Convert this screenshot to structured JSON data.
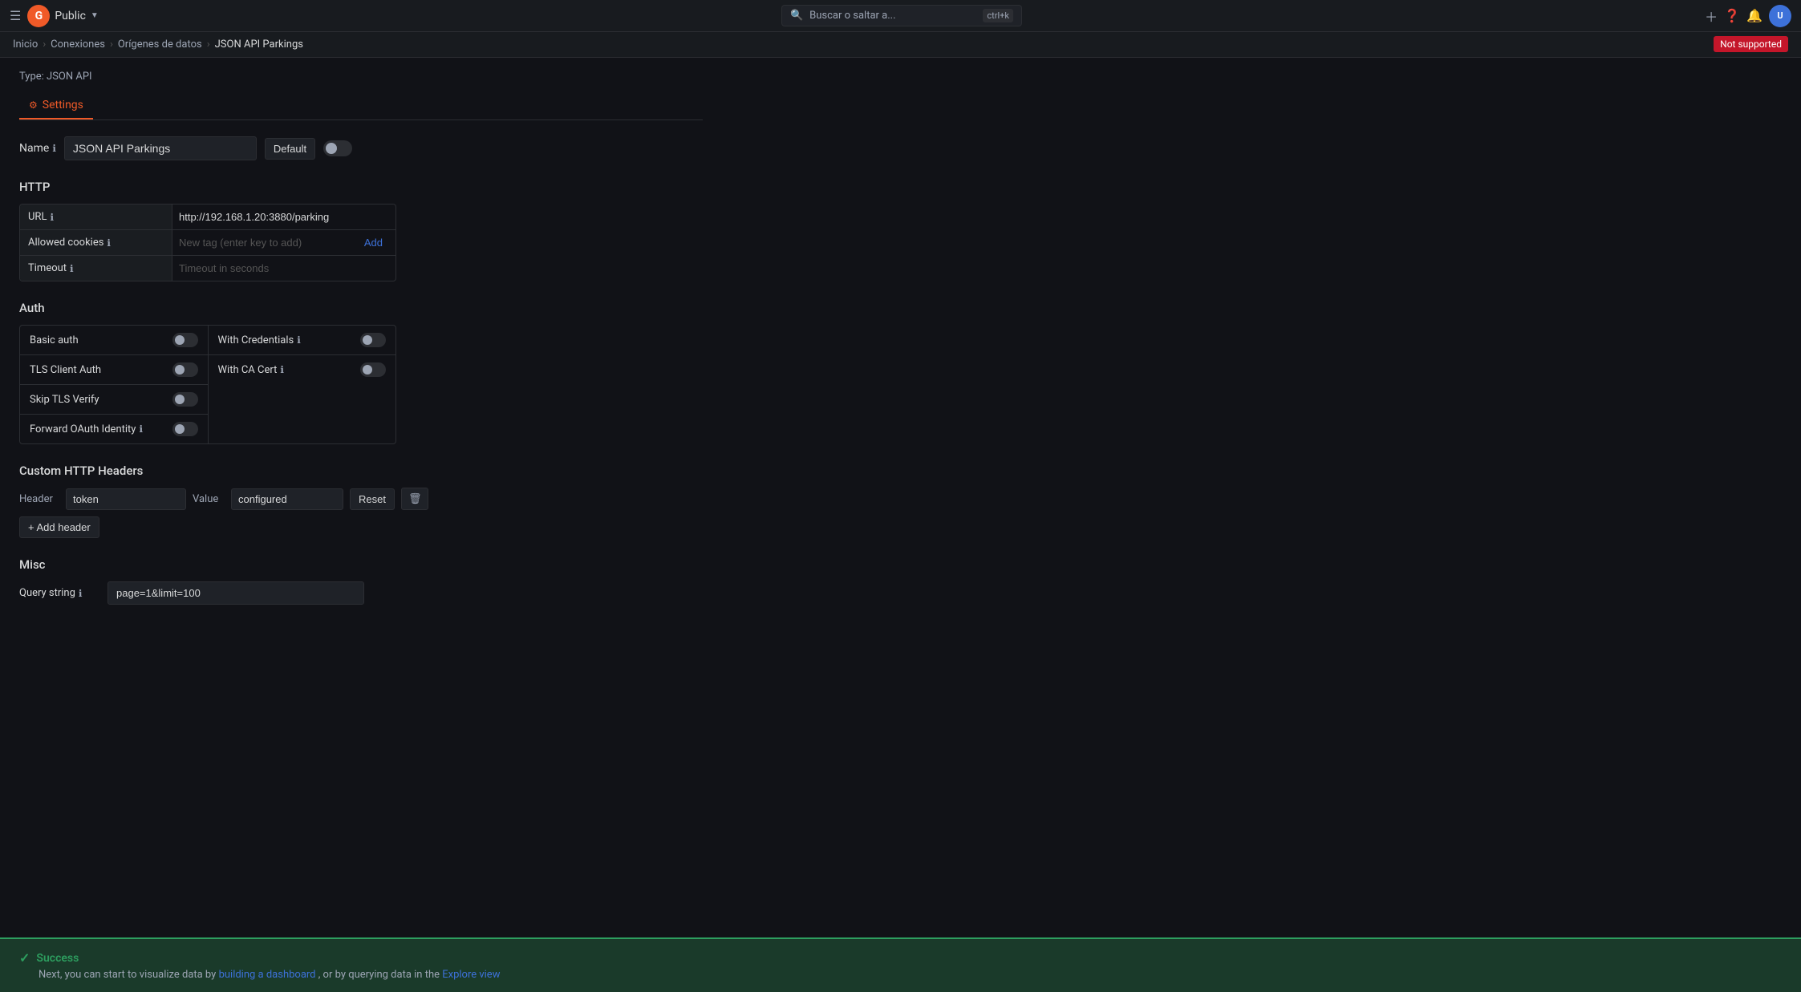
{
  "topnav": {
    "workspace": "Public",
    "search_placeholder": "Buscar o saltar a...",
    "search_shortcut": "ctrl+k",
    "brand_initial": "G"
  },
  "breadcrumb": {
    "items": [
      "Inicio",
      "Conexiones",
      "Orígenes de datos"
    ],
    "current": "JSON API Parkings",
    "not_supported_label": "Not supported"
  },
  "type_label": "Type: JSON API",
  "tabs": [
    {
      "label": "Settings",
      "active": true
    }
  ],
  "name_section": {
    "label": "Name",
    "value": "JSON API Parkings",
    "default_btn": "Default"
  },
  "http_section": {
    "title": "HTTP",
    "url_label": "URL",
    "url_value": "http://192.168.1.20:3880/parking",
    "allowed_cookies_label": "Allowed cookies",
    "allowed_cookies_placeholder": "New tag (enter key to add)",
    "allowed_cookies_add": "Add",
    "timeout_label": "Timeout",
    "timeout_placeholder": "Timeout in seconds"
  },
  "auth_section": {
    "title": "Auth",
    "rows_left": [
      {
        "label": "Basic auth"
      },
      {
        "label": "TLS Client Auth"
      },
      {
        "label": "Skip TLS Verify"
      },
      {
        "label": "Forward OAuth Identity"
      }
    ],
    "rows_right": [
      {
        "label": "With Credentials"
      },
      {
        "label": "With CA Cert"
      }
    ]
  },
  "custom_headers_section": {
    "title": "Custom HTTP Headers",
    "header_col_label": "Header",
    "header_value": "token",
    "value_col_label": "Value",
    "value_value": "configured",
    "reset_btn": "Reset",
    "add_btn": "+ Add header"
  },
  "misc_section": {
    "title": "Misc",
    "query_label": "Query string",
    "query_value": "page=1&limit=100"
  },
  "success_banner": {
    "title": "Success",
    "description": "Next, you can start to visualize data by",
    "link1_text": "building a dashboard",
    "link2_text": "Explore view"
  }
}
